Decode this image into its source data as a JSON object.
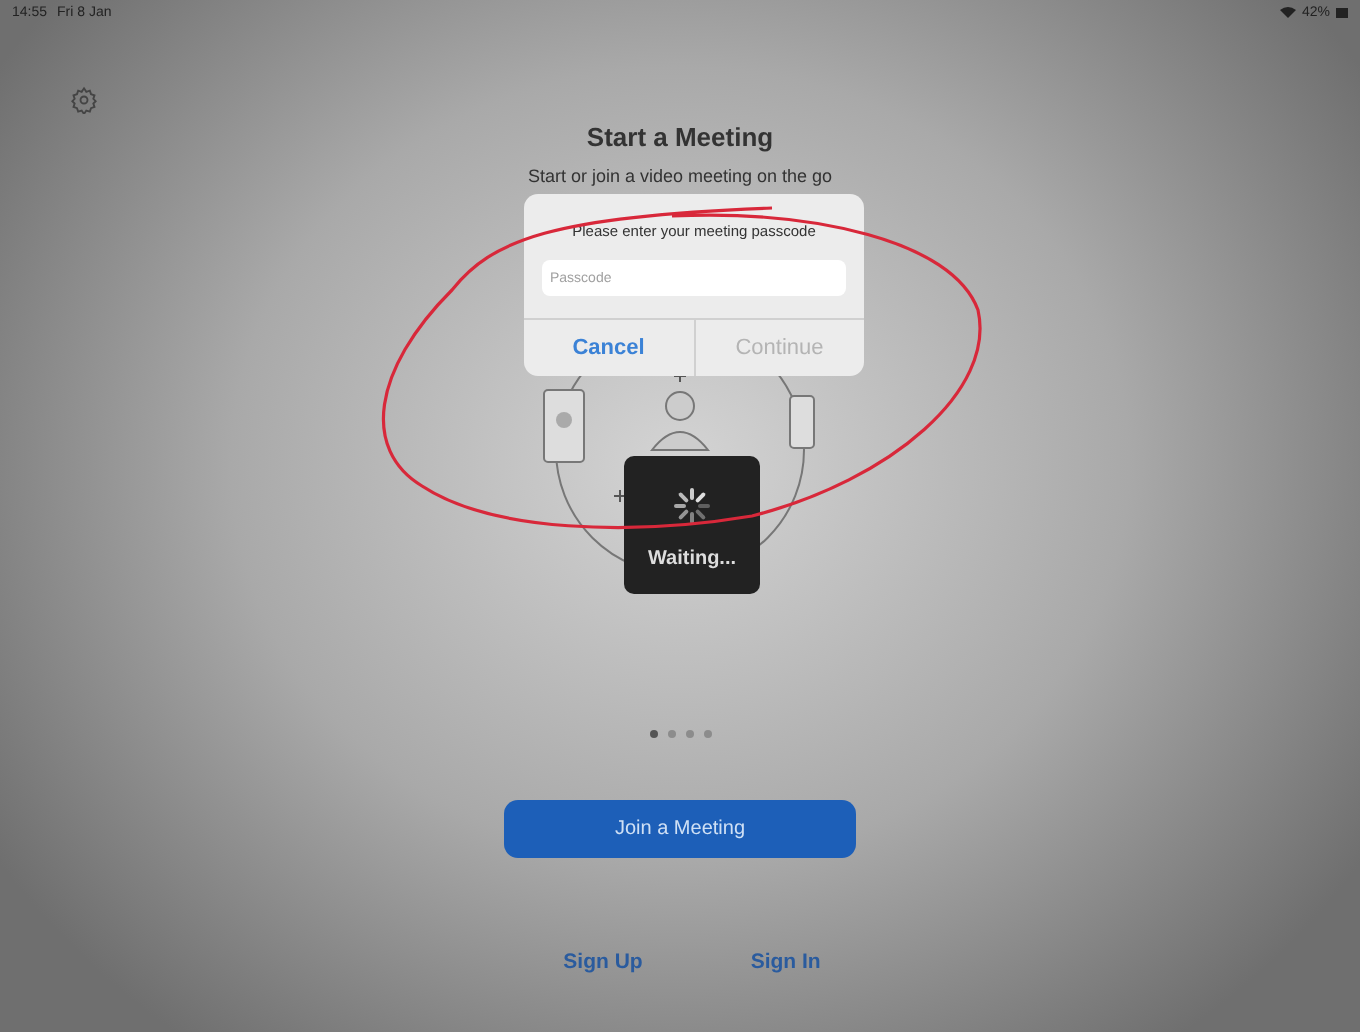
{
  "status_bar": {
    "time": "14:55",
    "date": "Fri 8 Jan",
    "battery": "42%"
  },
  "title": "Start a Meeting",
  "subtitle": "Start or join a video meeting on the go",
  "passcode_dialog": {
    "message": "Please enter your meeting passcode",
    "placeholder": "Passcode",
    "buttons": [
      {
        "label": "Cancel",
        "disabled": false
      },
      {
        "label": "Continue",
        "disabled": true
      }
    ]
  },
  "loading": {
    "label": "Waiting..."
  },
  "page_dots": [
    {
      "selected": true
    },
    {
      "selected": false
    },
    {
      "selected": false
    },
    {
      "selected": false
    }
  ],
  "join_button": "Join a Meeting",
  "links": [
    "Sign Up",
    "Sign In"
  ]
}
